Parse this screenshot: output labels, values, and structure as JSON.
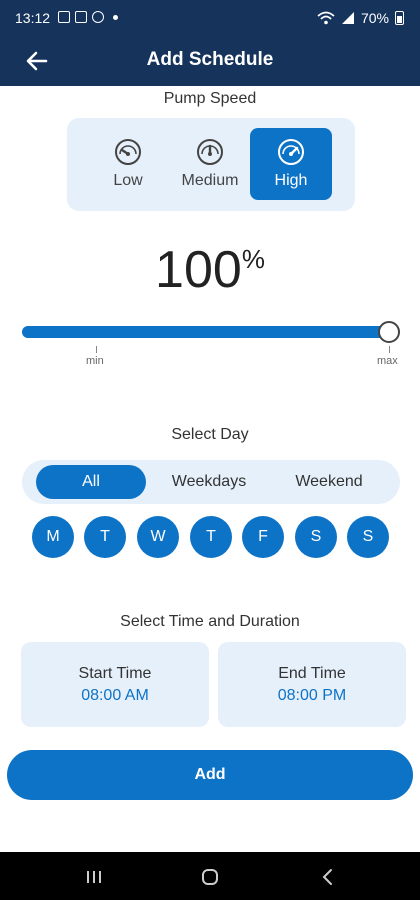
{
  "status_bar": {
    "time": "13:12",
    "battery_text": "70%",
    "icons": [
      "image-icon",
      "check-box-icon",
      "settings-snowflake-icon",
      "dot-icon",
      "wifi-icon",
      "signal-icon",
      "battery-icon"
    ]
  },
  "app_bar": {
    "title": "Add Schedule",
    "back_icon": "arrow-left-icon"
  },
  "pump_speed": {
    "label": "Pump Speed",
    "options": [
      {
        "label": "Low",
        "icon": "gauge-low-icon",
        "active": false
      },
      {
        "label": "Medium",
        "icon": "gauge-medium-icon",
        "active": false
      },
      {
        "label": "High",
        "icon": "gauge-high-icon",
        "active": true
      }
    ],
    "percent_value": "100",
    "percent_unit": "%",
    "slider": {
      "min_label": "min",
      "max_label": "max",
      "fraction": 1.0
    }
  },
  "day": {
    "label": "Select Day",
    "options": [
      {
        "label": "All",
        "active": true
      },
      {
        "label": "Weekdays",
        "active": false
      },
      {
        "label": "Weekend",
        "active": false
      }
    ],
    "days": [
      "M",
      "T",
      "W",
      "T",
      "F",
      "S",
      "S"
    ]
  },
  "time": {
    "label": "Select Time and Duration",
    "start": {
      "label": "Start Time",
      "value": "08:00 AM"
    },
    "end": {
      "label": "End Time",
      "value": "08:00 PM"
    }
  },
  "add_label": "Add",
  "nav": {
    "icons": [
      "recent-apps-icon",
      "home-icon",
      "back-chevron-icon"
    ]
  },
  "colors": {
    "primary": "#0d73c7",
    "header": "#16335c",
    "card": "#e6f0fa"
  }
}
